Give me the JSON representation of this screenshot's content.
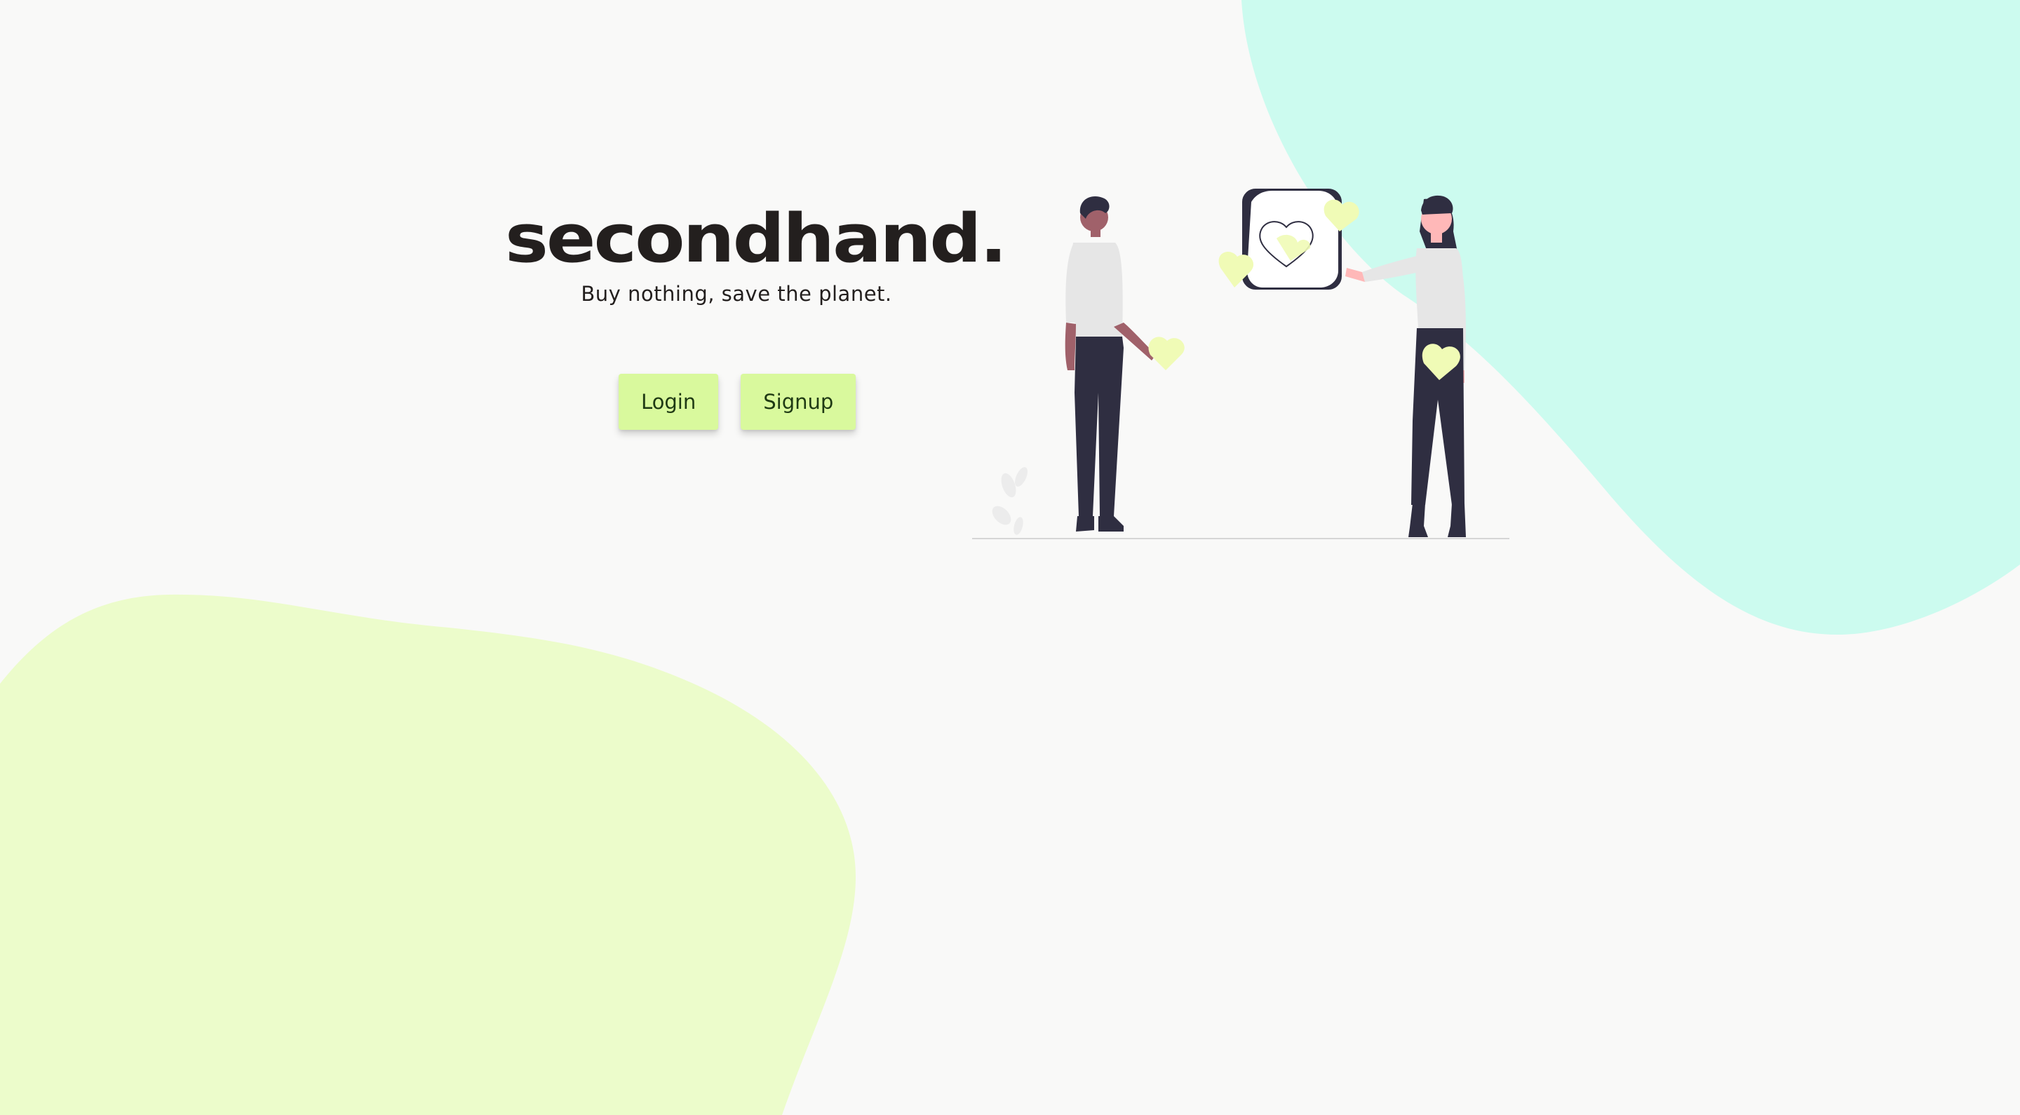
{
  "brand": {
    "name": "secondhand.",
    "tagline": "Buy nothing, save the planet."
  },
  "actions": {
    "login_label": "Login",
    "signup_label": "Signup"
  },
  "colors": {
    "background": "#f9f9f8",
    "blob_mint": "#ccfbef",
    "blob_lime": "#ecfccb",
    "button_bg": "#d9f99d",
    "heart_yellow": "#f0fbb6",
    "ink_dark": "#2f2e41"
  },
  "illustration": {
    "name": "two-people-exchanging-hearts"
  }
}
